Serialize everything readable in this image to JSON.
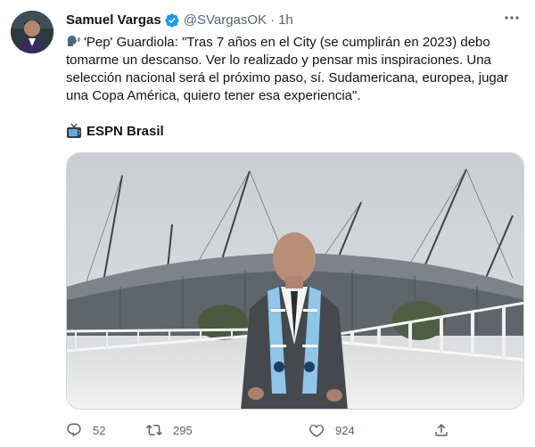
{
  "author": {
    "name": "Samuel Vargas",
    "handle": "@SVargasOK",
    "separator": "·",
    "time": "1h"
  },
  "tweet": {
    "text": "'Pep' Guardiola: \"Tras 7 años en el City (se cumplirán en 2023) debo tomarme un descanso. Ver lo realizado y pensar mis inspiraciones. Una selección nacional será el próximo paso, sí. Sudamericana, europea, jugar una Copa América, quiero tener esa experiencia\".",
    "source": "ESPN Brasil"
  },
  "icons": {
    "verified": "verified-badge-icon",
    "more": "more-options-icon",
    "speaking": "speaking-head-emoji-icon",
    "tv": "television-emoji-icon"
  },
  "stats": {
    "replies": "52",
    "retweets": "295",
    "likes": "924"
  },
  "colors": {
    "accent": "#1d9bf0",
    "secondary_text": "#536471",
    "primary_text": "#0f1419"
  }
}
